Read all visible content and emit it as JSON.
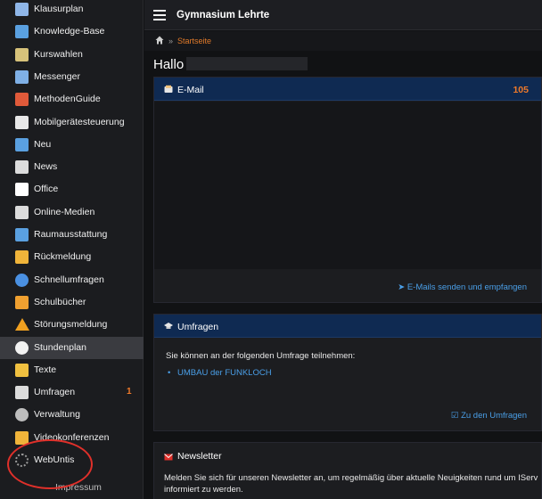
{
  "sidebar": {
    "items": [
      {
        "label": "Klausurplan",
        "icon": "calendar-icon",
        "color": "#8fb6e8"
      },
      {
        "label": "Knowledge-Base",
        "icon": "lightbulb-icon",
        "color": "#5aa0e0"
      },
      {
        "label": "Kurswahlen",
        "icon": "checkbox-icon",
        "color": "#d7c27a"
      },
      {
        "label": "Messenger",
        "icon": "chat-bubble-icon",
        "color": "#7fb0e6"
      },
      {
        "label": "MethodenGuide",
        "icon": "guide-icon",
        "color": "#e05a3a"
      },
      {
        "label": "Mobilgerätesteuerung",
        "icon": "device-icon",
        "color": "#e8e8e8"
      },
      {
        "label": "Neu",
        "icon": "new-icon",
        "color": "#5aa0e0"
      },
      {
        "label": "News",
        "icon": "newspaper-icon",
        "color": "#dcdcdc"
      },
      {
        "label": "Office",
        "icon": "office-icon",
        "color": "#ffffff"
      },
      {
        "label": "Online-Medien",
        "icon": "media-icon",
        "color": "#dcdcdc"
      },
      {
        "label": "Raumausstattung",
        "icon": "room-icon",
        "color": "#5aa0e0"
      },
      {
        "label": "Rückmeldung",
        "icon": "feedback-icon",
        "color": "#f0b43a"
      },
      {
        "label": "Schnellumfragen",
        "icon": "pie-chart-icon",
        "color": "#4a90e2"
      },
      {
        "label": "Schulbücher",
        "icon": "books-icon",
        "color": "#f0a030"
      },
      {
        "label": "Störungsmeldung",
        "icon": "warning-icon",
        "color": "#f0a020"
      },
      {
        "label": "Stundenplan",
        "icon": "clock-icon",
        "color": "#f2f2f2"
      },
      {
        "label": "Texte",
        "icon": "text-doc-icon",
        "color": "#f0c040"
      },
      {
        "label": "Umfragen",
        "icon": "survey-icon",
        "color": "#dcdcdc",
        "badge": "1"
      },
      {
        "label": "Verwaltung",
        "icon": "gear-icon",
        "color": "#bdbdbd"
      },
      {
        "label": "Videokonferenzen",
        "icon": "video-camera-icon",
        "color": "#f0b43a"
      },
      {
        "label": "WebUntis",
        "icon": "spinner-icon",
        "color": "#9a9a9a"
      }
    ],
    "active_index": 15,
    "impressum": "Impressum"
  },
  "header": {
    "school_name": "Gymnasium Lehrte",
    "breadcrumb_sep": "»",
    "breadcrumb": "Startseite"
  },
  "main": {
    "greeting": "Hallo",
    "email": {
      "title": "E-Mail",
      "count": "105",
      "footer_link": "E-Mails senden und empfangen"
    },
    "umfragen": {
      "title": "Umfragen",
      "text": "Sie können an der folgenden Umfrage teilnehmen:",
      "item": "UMBAU der FUNKLOCH",
      "footer_link": "Zu den Umfragen"
    },
    "newsletter": {
      "title": "Newsletter",
      "text": "Melden Sie sich für unseren Newsletter an, um regelmäßig über aktuelle Neuigkeiten rund um IServ informiert zu werden."
    }
  },
  "colors": {
    "accent_orange": "#f07a2a",
    "link_blue": "#4a9fe8",
    "panel_header": "#0f2a52",
    "annotation_red": "#e0302a"
  }
}
